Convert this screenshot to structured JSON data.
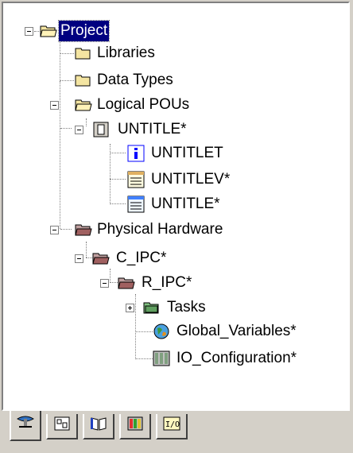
{
  "tree": {
    "project": "Project",
    "libraries": "Libraries",
    "data_types": "Data Types",
    "logical_pous": "Logical POUs",
    "untitle_program": "UNTITLE*",
    "untitlet": "UNTITLET",
    "untitlev": "UNTITLEV*",
    "untitle_code": "UNTITLE*",
    "physical_hardware": "Physical Hardware",
    "c_ipc": "C_IPC*",
    "r_ipc": "R_IPC*",
    "tasks": "Tasks",
    "global_variables": "Global_Variables*",
    "io_configuration": "IO_Configuration*"
  },
  "tabs": [
    {
      "icon": "project-tree-icon",
      "active": true
    },
    {
      "icon": "pou-icon",
      "active": false
    },
    {
      "icon": "library-book-icon",
      "active": false
    },
    {
      "icon": "hardware-icon",
      "active": false
    },
    {
      "icon": "io-config-icon",
      "active": false
    }
  ],
  "colors": {
    "selection": "#000080",
    "folder": "#f4e5a2",
    "hardware_folder": "#c0a0a0"
  }
}
